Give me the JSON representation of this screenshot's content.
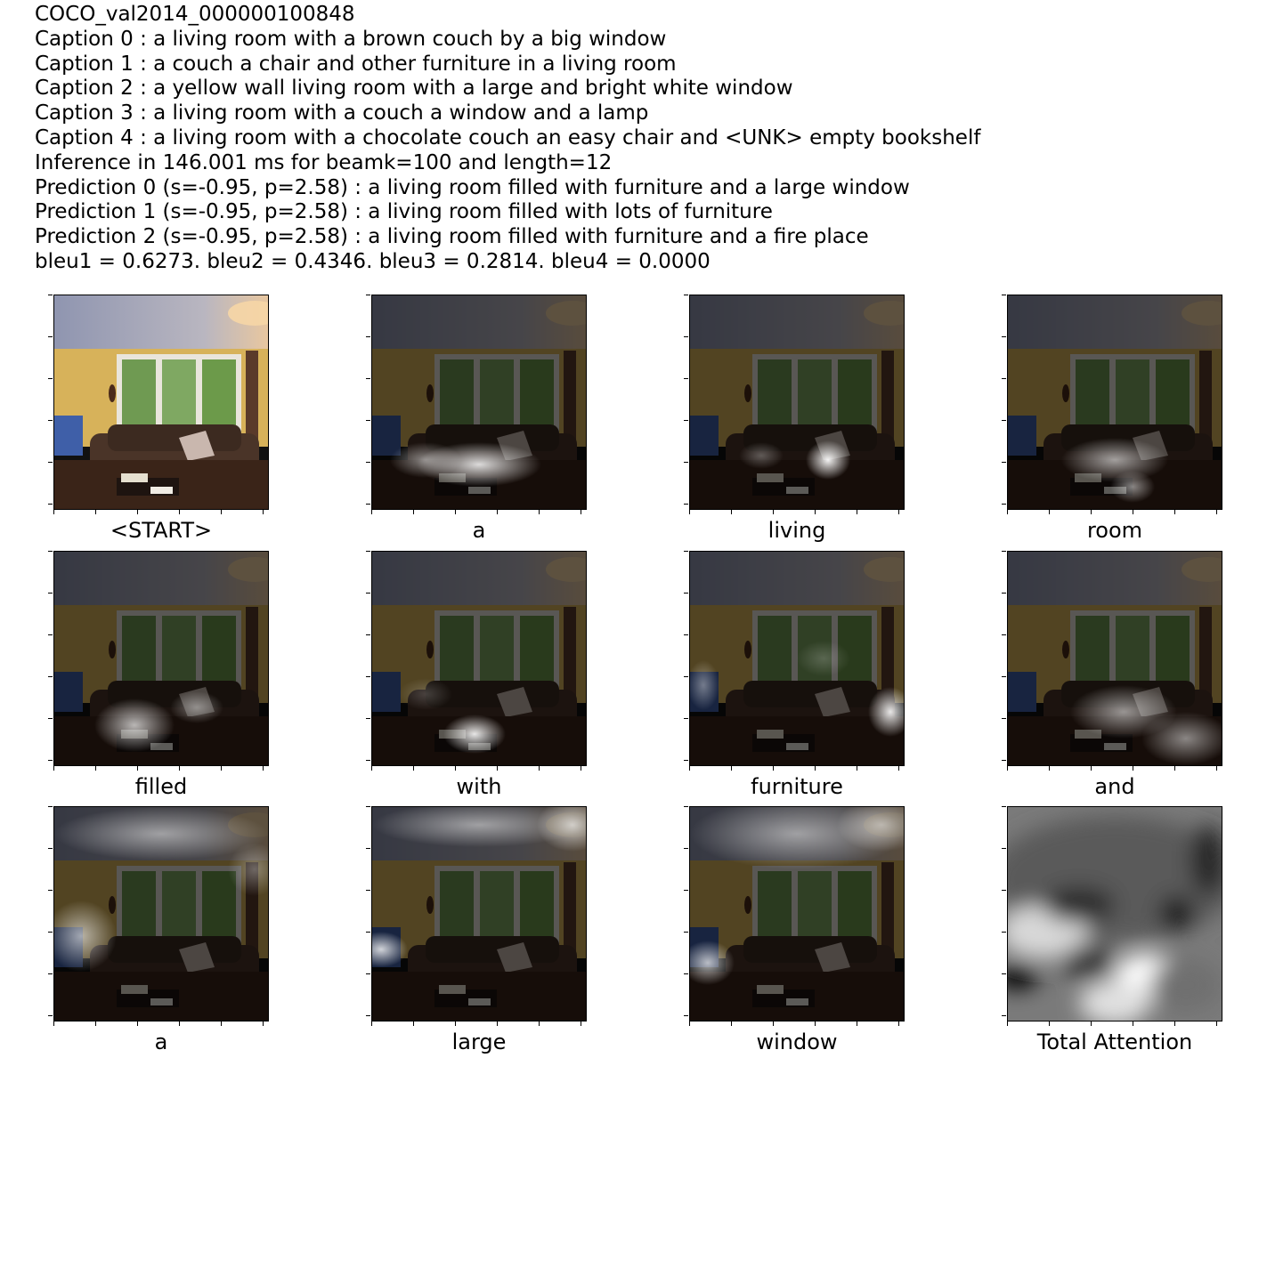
{
  "header": {
    "image_id": "COCO_val2014_000000100848",
    "captions": [
      "Caption 0 : a living room with a brown couch by a big window",
      "Caption 1 : a couch a chair and other furniture in a living room",
      "Caption 2 : a yellow wall living room with a large and bright white window",
      "Caption 3 : a living room with a couch a window and a lamp",
      "Caption 4 : a living room with a chocolate couch an easy chair and <UNK> empty bookshelf"
    ],
    "inference": "Inference in 146.001 ms for beamk=100 and length=12",
    "predictions": [
      "Prediction 0 (s=-0.95, p=2.58) : a living room filled with furniture and a large window",
      "Prediction 1 (s=-0.95, p=2.58) : a living room filled with lots of furniture",
      "Prediction 2 (s=-0.95, p=2.58) : a living room filled with furniture and a fire place"
    ],
    "bleu": "bleu1 = 0.6273. bleu2 = 0.4346. bleu3 = 0.2814. bleu4 = 0.0000"
  },
  "panels": [
    {
      "label": "<START>"
    },
    {
      "label": "a"
    },
    {
      "label": "living"
    },
    {
      "label": "room"
    },
    {
      "label": "filled"
    },
    {
      "label": "with"
    },
    {
      "label": "furniture"
    },
    {
      "label": "and"
    },
    {
      "label": "a"
    },
    {
      "label": "large"
    },
    {
      "label": "window"
    },
    {
      "label": "Total Attention"
    }
  ]
}
